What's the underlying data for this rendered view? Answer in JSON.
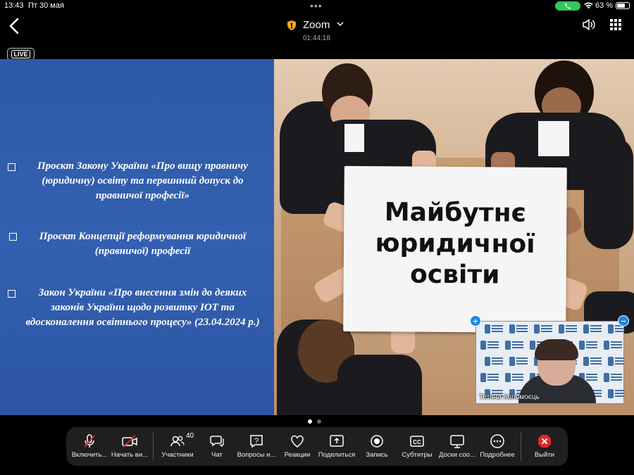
{
  "status_bar": {
    "time": "13:43",
    "date": "Пт 30 мая",
    "battery_percent": "63 %",
    "battery_level": 0.63,
    "call_indicator_color": "#34c759"
  },
  "header": {
    "title": "Zoom",
    "duration": "01:44:18",
    "back_icon": "chevron-left-icon",
    "shield_color": "#f5a623"
  },
  "live_badge": "LIVE",
  "slide": {
    "bullets": [
      "Проєкт Закону України «Про вищу правничу (юридичну) освіту та первинний допуск до правничої професії»",
      "Проєкт Концепції реформування юридичної (правничої) професії",
      "Закон України «Про внесення змін до деяких законів України щодо розвитку ІОТ та вдосконалення освітнього процесу» (23.04.2024 р.)"
    ],
    "sign_lines": [
      "Майбутнє",
      "юридичної",
      "освіти"
    ],
    "left_bg": "#3360b0"
  },
  "self_view": {
    "name": "Тетяна Коломоєць"
  },
  "toolbar": {
    "items": [
      {
        "label": "Включить...",
        "icon": "microphone-muted-icon"
      },
      {
        "label": "Начать ви...",
        "icon": "video-off-icon"
      },
      {
        "label": "Участники",
        "icon": "participants-icon",
        "count": "40"
      },
      {
        "label": "Чат",
        "icon": "chat-icon"
      },
      {
        "label": "Вопросы и...",
        "icon": "qa-icon"
      },
      {
        "label": "Реакции",
        "icon": "heart-icon"
      },
      {
        "label": "Поделиться",
        "icon": "share-icon"
      },
      {
        "label": "Запись",
        "icon": "record-icon"
      },
      {
        "label": "Субтитры",
        "icon": "cc-icon"
      },
      {
        "label": "Доски соо...",
        "icon": "whiteboard-icon"
      },
      {
        "label": "Подробнее",
        "icon": "more-icon"
      },
      {
        "label": "Выйти",
        "icon": "leave-icon"
      }
    ],
    "leave_color": "#e02828",
    "muted_color": "#e02828"
  }
}
